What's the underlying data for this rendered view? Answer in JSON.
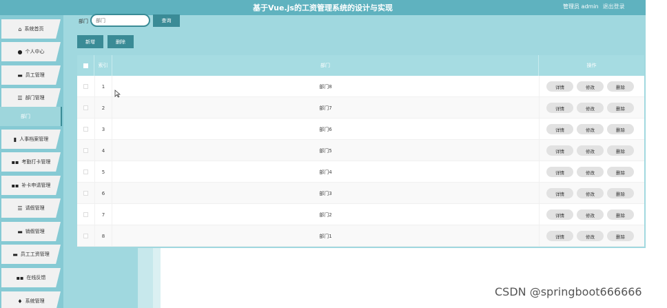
{
  "header": {
    "title": "基于Vue.js的工资管理系统的设计与实现",
    "user": "管理员 admin",
    "logout": "退出登录"
  },
  "sidebar": {
    "items": [
      {
        "label": "系统首页",
        "icon": "home-icon"
      },
      {
        "label": "个人中心",
        "icon": "user-icon"
      },
      {
        "label": "员工管理",
        "icon": "briefcase-icon"
      },
      {
        "label": "部门管理",
        "icon": "list-icon"
      },
      {
        "label": "人事档案管理",
        "icon": "file-icon"
      },
      {
        "label": "考勤打卡管理",
        "icon": "grid-icon"
      },
      {
        "label": "补卡申请管理",
        "icon": "grid-icon"
      },
      {
        "label": "请假管理",
        "icon": "list-icon"
      },
      {
        "label": "销假管理",
        "icon": "monitor-icon"
      },
      {
        "label": "员工工资管理",
        "icon": "monitor-icon"
      },
      {
        "label": "在线反馈",
        "icon": "grid-icon"
      },
      {
        "label": "系统管理",
        "icon": "pin-icon"
      }
    ],
    "active_sub": "部门"
  },
  "search": {
    "label": "部门",
    "placeholder": "部门",
    "button": "查询"
  },
  "toolbar": {
    "add": "新增",
    "delete": "删除"
  },
  "table": {
    "headers": {
      "index": "索引",
      "dept": "部门",
      "ops": "操作"
    },
    "rows": [
      {
        "index": "1",
        "dept": "部门8"
      },
      {
        "index": "2",
        "dept": "部门7"
      },
      {
        "index": "3",
        "dept": "部门6"
      },
      {
        "index": "4",
        "dept": "部门5"
      },
      {
        "index": "5",
        "dept": "部门4"
      },
      {
        "index": "6",
        "dept": "部门3"
      },
      {
        "index": "7",
        "dept": "部门2"
      },
      {
        "index": "8",
        "dept": "部门1"
      }
    ],
    "actions": {
      "detail": "详情",
      "edit": "修改",
      "delete": "删除"
    }
  },
  "watermark": "CSDN @springboot666666",
  "colors": {
    "header": "#5fb2bf",
    "accent": "#3a8b96",
    "content_bg": "#a0d8df",
    "table_header": "#a6dce2"
  }
}
